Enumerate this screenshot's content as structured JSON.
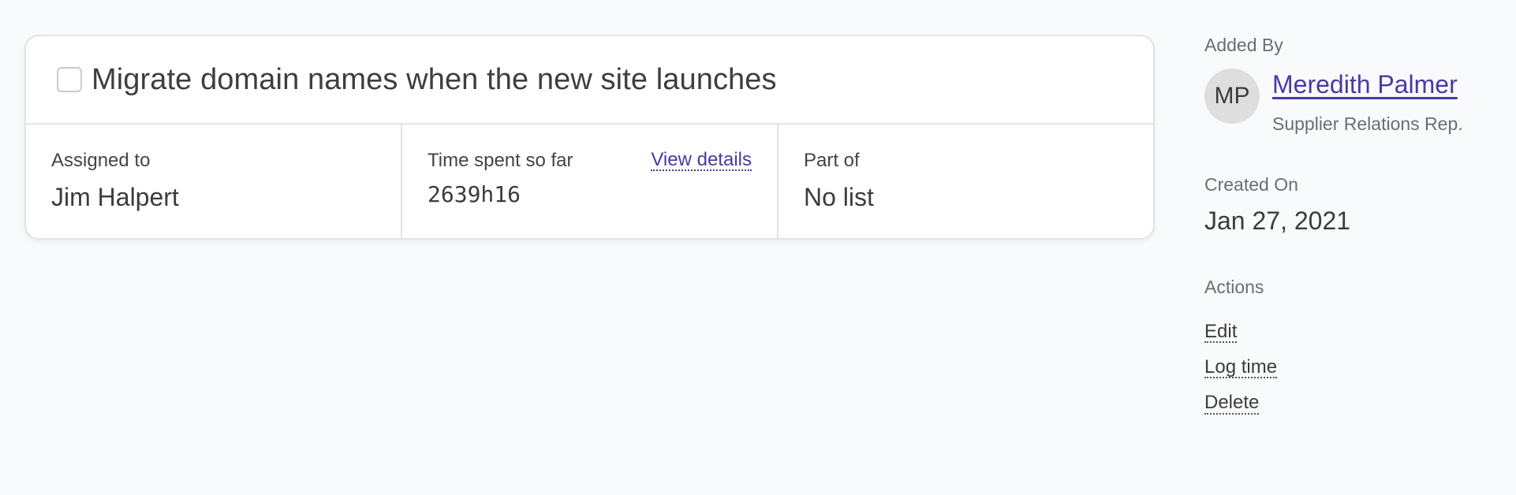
{
  "task": {
    "title": "Migrate domain names when the new site launches",
    "checked": false
  },
  "details": {
    "assigned": {
      "label": "Assigned to",
      "value": "Jim Halpert"
    },
    "time": {
      "label": "Time spent so far",
      "value": "2639h16",
      "link": "View details"
    },
    "part_of": {
      "label": "Part of",
      "value": "No list"
    }
  },
  "sidebar": {
    "added_by": {
      "label": "Added By",
      "initials": "MP",
      "name": "Meredith Palmer",
      "role": "Supplier Relations Rep."
    },
    "created_on": {
      "label": "Created On",
      "value": "Jan 27, 2021"
    },
    "actions": {
      "label": "Actions",
      "items": [
        "Edit",
        "Log time",
        "Delete"
      ]
    }
  },
  "colors": {
    "link": "#4a3aa3",
    "background": "#f9fafc",
    "card_border": "#e1e3e8"
  }
}
